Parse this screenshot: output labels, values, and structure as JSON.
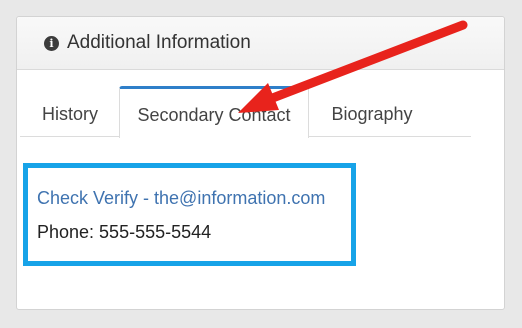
{
  "panel": {
    "icon": "info-circle-icon",
    "title": "Additional Information"
  },
  "tabs": [
    {
      "label": "History",
      "active": false
    },
    {
      "label": "Secondary Contact",
      "active": true
    },
    {
      "label": "Biography",
      "active": false
    }
  ],
  "contact": {
    "link_text": "Check Verify - the@information.com",
    "phone_text": "Phone: 555-555-5544"
  },
  "colors": {
    "accent_tab": "#2f7fc9",
    "highlight_box": "#17a3e8",
    "annotation_arrow": "#e8231c",
    "link": "#3f73b0"
  }
}
